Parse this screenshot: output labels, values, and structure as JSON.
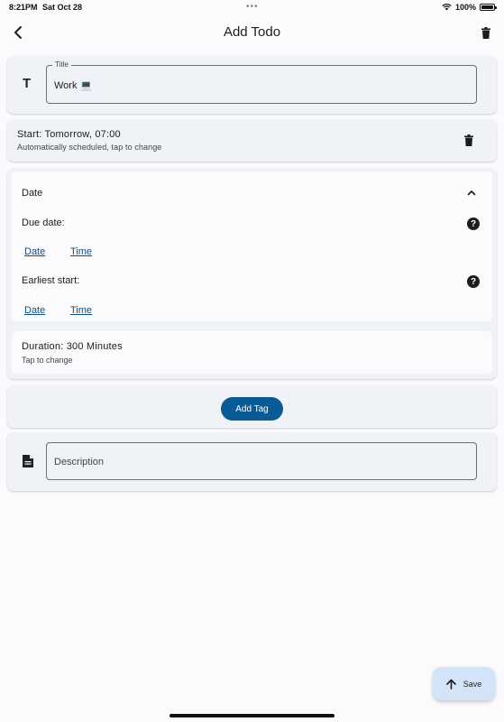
{
  "status_bar": {
    "time": "8:21PM",
    "date": "Sat Oct 28",
    "dots": "•••",
    "battery_text": "100%",
    "battery_level": 1.0
  },
  "app_bar": {
    "title": "Add Todo",
    "back_icon": "chevron-left-icon",
    "delete_icon": "trash-icon"
  },
  "title_field": {
    "label": "Title",
    "value": "Work 💻",
    "icon": "text-t-icon"
  },
  "start": {
    "text": "Start: Tomorrow, 07:00",
    "subtitle": "Automatically scheduled, tap to change",
    "delete_icon": "trash-icon"
  },
  "date_section": {
    "header": "Date",
    "due_label": "Due date:",
    "due_date_link": "Date",
    "due_time_link": "Time",
    "earliest_label": "Earliest start:",
    "earliest_date_link": "Date",
    "earliest_time_link": "Time"
  },
  "duration": {
    "text": "Duration: 300 Minutes",
    "subtitle": "Tap to change"
  },
  "tags": {
    "add_label": "Add Tag"
  },
  "description": {
    "placeholder": "Description",
    "icon": "document-icon"
  },
  "save_fab": {
    "label": "Save",
    "icon": "arrow-up-icon"
  },
  "colors": {
    "accent": "#0a5a96",
    "link": "#0f4c81",
    "card_bg": "#eff2f6",
    "fab_bg": "#d3e4f8"
  }
}
